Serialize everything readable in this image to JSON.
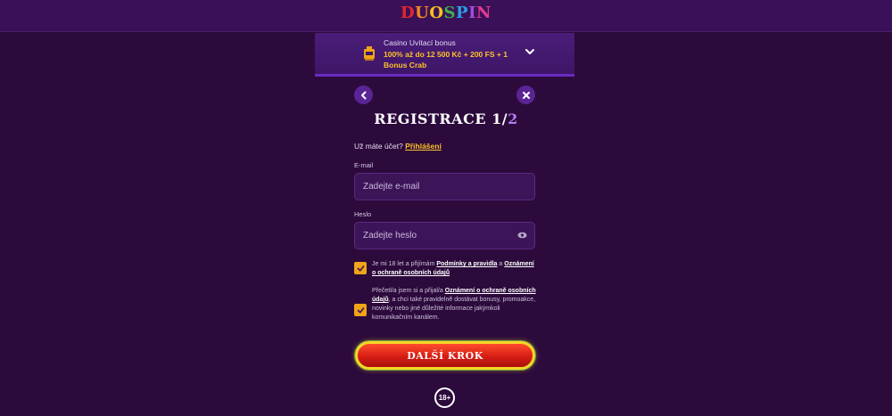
{
  "header": {
    "logo_letters": [
      "D",
      "U",
      "O",
      "S",
      "P",
      "I",
      "N"
    ],
    "logo_colors": [
      "#e8262b",
      "#f58a1f",
      "#f6c21c",
      "#3bb34a",
      "#2c9ee4",
      "#a14fd6",
      "#e23a8f"
    ]
  },
  "bonus": {
    "title": "Casino Uvítací bonus",
    "offer": "100% až do 12 500 Kč + 200 FS + 1 Bonus Crab",
    "icon": "slot-machine-icon"
  },
  "nav": {
    "back_icon": "chevron-left-icon",
    "close_icon": "close-icon"
  },
  "form": {
    "title_main": "REGISTRACE 1/",
    "title_step": "2",
    "have_account": "Už máte účet?",
    "login_link": "Přihlášení",
    "email_label": "E-mail",
    "email_placeholder": "Zadejte e-mail",
    "password_label": "Heslo",
    "password_placeholder": "Zadejte heslo",
    "consent1": {
      "text_a": "Je mi 18 let a přijímám ",
      "link_a": "Podmínky a pravidla",
      "text_b": " a ",
      "link_b": "Oznámení o ochraně osobních údajů"
    },
    "consent2": {
      "text_a": "Přečetl/a jsem si a přijal/a ",
      "link_a": "Oznámení o ochraně osobních údajů",
      "text_b": ", a chci také pravidelně dostávat bonusy, promoakce, novinky nebo jiné důležité informace jakýmkoli komunikačním kanálem."
    },
    "next_button": "DALŠÍ KROK"
  },
  "footer": {
    "age_badge": "18+"
  },
  "colors": {
    "background": "#2c0a3c",
    "accent_yellow": "#ffc228",
    "accent_purple": "#b57cf0",
    "checkbox": "#f0a418",
    "button_red": "#d71d14"
  }
}
